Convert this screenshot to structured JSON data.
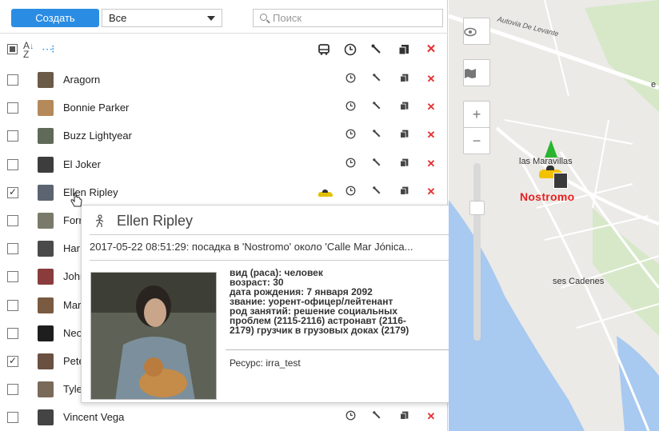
{
  "toolbar": {
    "create_label": "Создать",
    "filter_value": "Все",
    "search_placeholder": "Поиск"
  },
  "header": {
    "sort_icon": "sort-az-icon",
    "group_icon": "group-icon",
    "columns": [
      "bus-icon",
      "clock-icon",
      "wrench-icon",
      "copy-icon",
      "delete-icon"
    ]
  },
  "list": {
    "rows": [
      {
        "name": "Aragorn",
        "checked": false,
        "avatar_color": "#6b5a48"
      },
      {
        "name": "Bonnie Parker",
        "checked": false,
        "avatar_color": "#b48a5a"
      },
      {
        "name": "Buzz Lightyear",
        "checked": false,
        "avatar_color": "#5f6b58"
      },
      {
        "name": "El Joker",
        "checked": false,
        "avatar_color": "#3d3d3d"
      },
      {
        "name": "Ellen Ripley",
        "checked": true,
        "avatar_color": "#5b6470",
        "has_car": true
      },
      {
        "name": "Forrest Gump",
        "checked": false,
        "avatar_color": "#7a7a6a",
        "visible": "Forr"
      },
      {
        "name": "Han",
        "checked": false,
        "avatar_color": "#4a4a4a",
        "visible": "Har"
      },
      {
        "name": "John McClane",
        "checked": false,
        "avatar_color": "#8a3b3b",
        "visible": "John"
      },
      {
        "name": "Marty McFly",
        "checked": false,
        "avatar_color": "#7a5a40",
        "visible": "Mart"
      },
      {
        "name": "Neo",
        "checked": false,
        "avatar_color": "#1e1e1e",
        "visible": "Neo"
      },
      {
        "name": "Peter Venkman",
        "checked": true,
        "avatar_color": "#6a5040",
        "visible": "Pete"
      },
      {
        "name": "Tyler Durden",
        "checked": false,
        "avatar_color": "#7a6a5a",
        "visible": "Tyle"
      },
      {
        "name": "Vincent Vega",
        "checked": false,
        "avatar_color": "#444444"
      }
    ]
  },
  "popup": {
    "title": "Ellen Ripley",
    "event": "2017-05-22 08:51:29: посадка в 'Nostromo' около 'Calle Mar Jónica...",
    "details": [
      "вид (раса): человек",
      "возраст: 30",
      "дата рождения: 7 января 2092",
      "звание: уорент-офицер/лейтенант",
      "род занятий: решение социальных",
      "проблем (2115-2116) астронавт (2116-",
      "2179) грузчик в грузовых доках (2179)"
    ],
    "resource": "Ресурс: irra_test"
  },
  "map": {
    "label_road": "Autovia De Levante",
    "label_maravillas": "las Maravillas",
    "label_cadenes": "ses Cadenes",
    "label_vehicle": "Nostromo",
    "label_edge": "e",
    "zoom_in": "+",
    "zoom_out": "−",
    "colors": {
      "sea": "#a8c9f0",
      "land": "#ebeae7",
      "vehicle_label": "#e82020",
      "nav_arrow": "#29b52f"
    }
  },
  "colors": {
    "accent": "#2b8ce3",
    "delete": "#e53030"
  }
}
